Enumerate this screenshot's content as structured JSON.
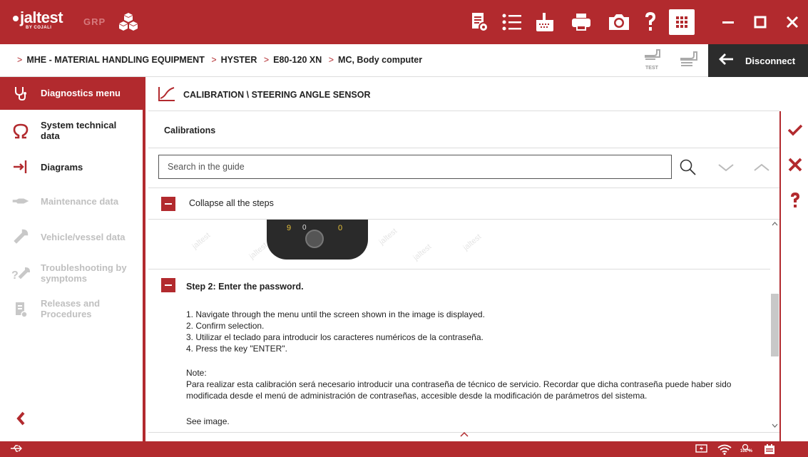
{
  "app": {
    "logo": "jaltest",
    "logo_sub": "BY COJALI",
    "grp": "GRP",
    "toolbar_icons": [
      "report-icon",
      "list-icon",
      "connector-icon",
      "print-icon",
      "camera-icon",
      "help-icon"
    ],
    "window_icons": [
      "apps-grid-icon",
      "minimize-icon",
      "maximize-icon",
      "close-icon"
    ]
  },
  "breadcrumb": {
    "items": [
      "MHE - MATERIAL HANDLING EQUIPMENT",
      "HYSTER",
      "E80-120 XN",
      "MC, Body computer"
    ],
    "test_label": "TEST",
    "disconnect_label": "Disconnect"
  },
  "sidebar": {
    "items": [
      {
        "label": "Diagnostics menu",
        "icon": "stethoscope-icon",
        "state": "active"
      },
      {
        "label": "System technical data",
        "icon": "omega-icon",
        "state": "enabled"
      },
      {
        "label": "Diagrams",
        "icon": "diagram-icon",
        "state": "enabled"
      },
      {
        "label": "Maintenance data",
        "icon": "oil-can-icon",
        "state": "disabled"
      },
      {
        "label": "Vehicle/vessel data",
        "icon": "wrench-icon",
        "state": "disabled"
      },
      {
        "label": "Troubleshooting by symptoms",
        "icon": "troubleshoot-icon",
        "state": "disabled"
      },
      {
        "label": "Releases and Procedures",
        "icon": "document-icon",
        "state": "disabled"
      }
    ]
  },
  "main": {
    "title": "CALIBRATION \\ STEERING ANGLE SENSOR",
    "section_title": "Calibrations",
    "search_placeholder": "Search in the guide",
    "collapse_label": "Collapse all the steps",
    "image_digits": {
      "left": "9",
      "mid": "0",
      "right": "0"
    },
    "watermark": "jaltest",
    "step_title": "Step 2: Enter the password.",
    "step_lines": [
      "1. Navigate through the menu until the screen shown in the image is displayed.",
      "2. Confirm selection.",
      "3. Utilizar el teclado para introducir los caracteres numéricos de la contraseña.",
      "4. Press the key \"ENTER\"."
    ],
    "note_label": "Note:",
    "note_text": "Para realizar esta calibración será necesario introducir una contraseña de técnico de servicio. Recordar que dicha contraseña puede haber sido modificada desde el menú de administración de contraseñas, accesible desde la modificación de parámetros del sistema.",
    "see_image": "See image."
  },
  "actions": [
    "accept-check-icon",
    "cancel-x-icon",
    "help-question-icon"
  ],
  "status": {
    "zoom": "100 %"
  },
  "colors": {
    "accent": "#b22a2e",
    "dark": "#2c2c2c",
    "disabled": "#c0c0c0"
  }
}
